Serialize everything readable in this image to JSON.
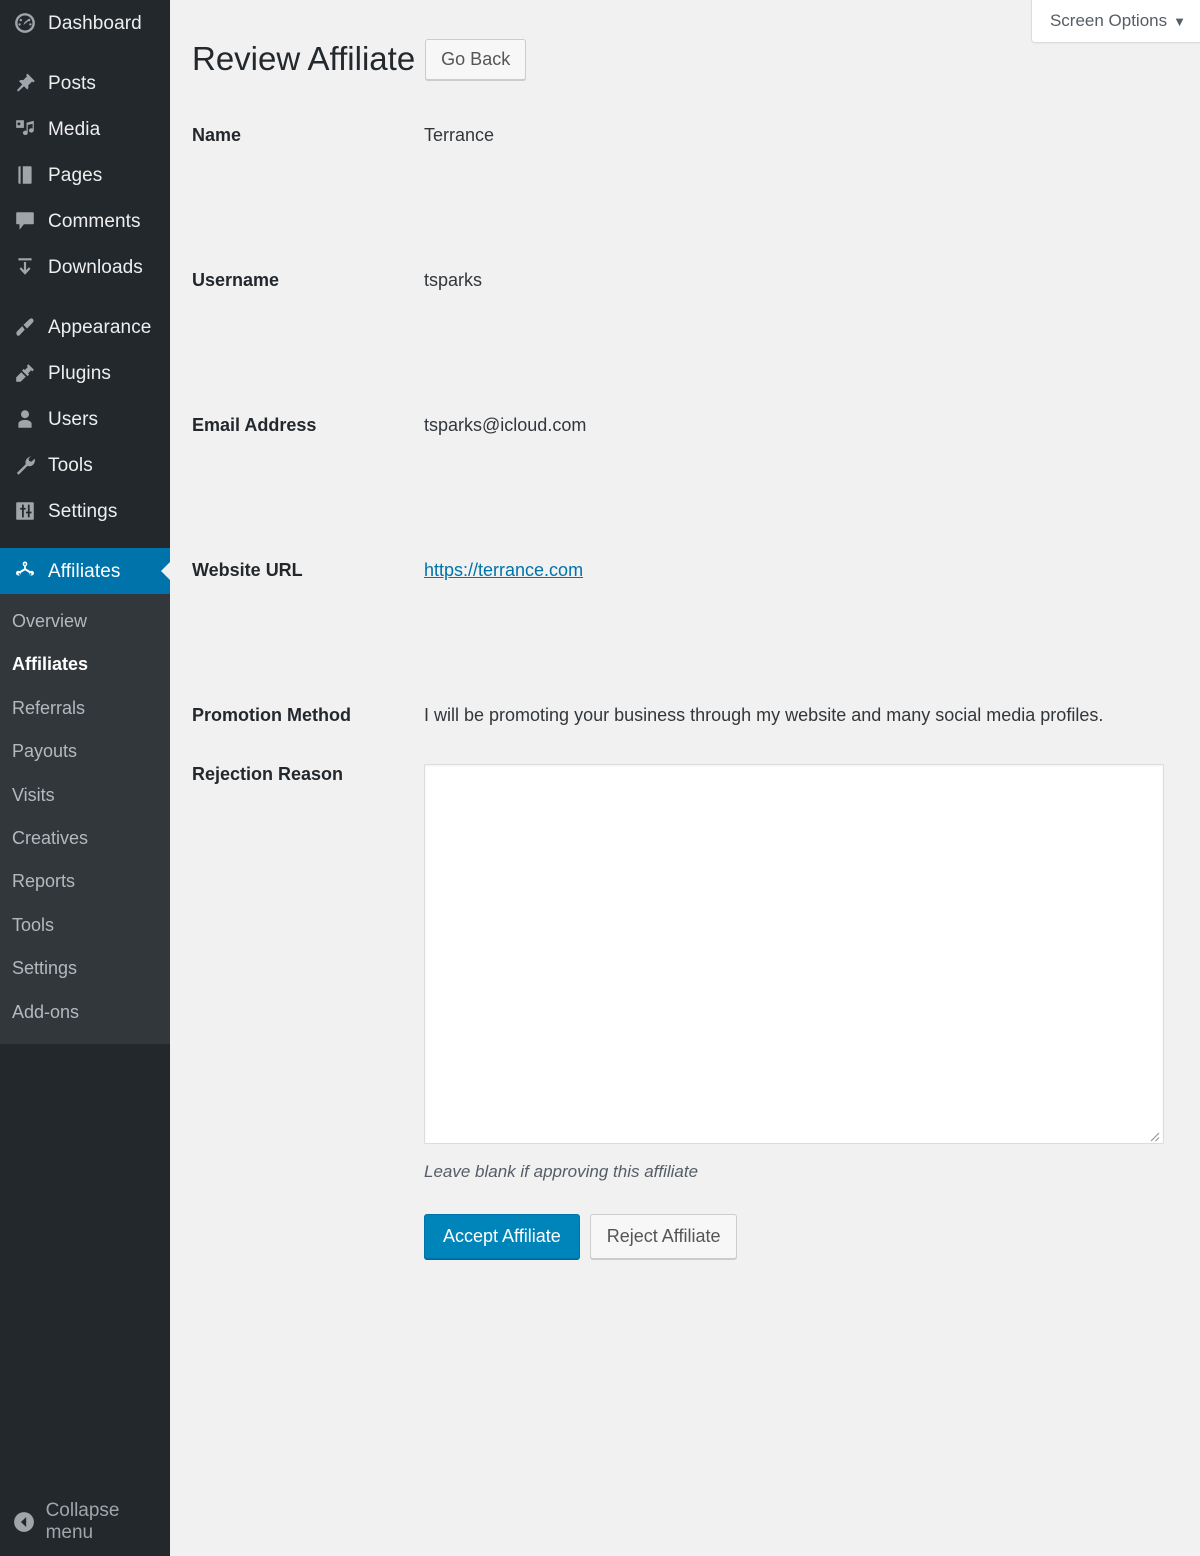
{
  "sidebar": {
    "items": [
      {
        "label": "Dashboard",
        "icon": "dashboard-icon",
        "name": "dashboard"
      },
      {
        "label": "Posts",
        "icon": "pin-icon",
        "name": "posts"
      },
      {
        "label": "Media",
        "icon": "media-icon",
        "name": "media"
      },
      {
        "label": "Pages",
        "icon": "pages-icon",
        "name": "pages"
      },
      {
        "label": "Comments",
        "icon": "comment-icon",
        "name": "comments"
      },
      {
        "label": "Downloads",
        "icon": "download-icon",
        "name": "downloads"
      },
      {
        "label": "Appearance",
        "icon": "brush-icon",
        "name": "appearance"
      },
      {
        "label": "Plugins",
        "icon": "plug-icon",
        "name": "plugins"
      },
      {
        "label": "Users",
        "icon": "user-icon",
        "name": "users"
      },
      {
        "label": "Tools",
        "icon": "wrench-icon",
        "name": "tools"
      },
      {
        "label": "Settings",
        "icon": "sliders-icon",
        "name": "settings"
      },
      {
        "label": "Affiliates",
        "icon": "network-icon",
        "name": "affiliates",
        "active": true
      }
    ],
    "submenu": [
      {
        "label": "Overview",
        "name": "overview"
      },
      {
        "label": "Affiliates",
        "name": "affiliates",
        "active": true
      },
      {
        "label": "Referrals",
        "name": "referrals"
      },
      {
        "label": "Payouts",
        "name": "payouts"
      },
      {
        "label": "Visits",
        "name": "visits"
      },
      {
        "label": "Creatives",
        "name": "creatives"
      },
      {
        "label": "Reports",
        "name": "reports"
      },
      {
        "label": "Tools",
        "name": "tools"
      },
      {
        "label": "Settings",
        "name": "settings"
      },
      {
        "label": "Add-ons",
        "name": "add-ons"
      }
    ],
    "collapse_label": "Collapse menu",
    "collapse_icon": "chevron-left-circle-icon",
    "colors": {
      "background": "#23282d",
      "submenu_background": "#32373c",
      "active": "#0073aa",
      "text": "#a0a5aa"
    }
  },
  "screen_meta": {
    "screen_options_label": "Screen Options",
    "caret": "▼"
  },
  "header": {
    "title": "Review Affiliate",
    "go_back_label": "Go Back"
  },
  "form": {
    "fields": [
      {
        "label": "Name",
        "value": "Terrance",
        "name": "name"
      },
      {
        "label": "Username",
        "value": "tsparks",
        "name": "username"
      },
      {
        "label": "Email Address",
        "value": "tsparks@icloud.com",
        "name": "email-address"
      },
      {
        "label": "Website URL",
        "value": "https://terrance.com",
        "name": "website-url",
        "is_link": true
      },
      {
        "label": "Promotion Method",
        "value": "I will be promoting your business through my website and many social media profiles.",
        "name": "promotion-method"
      }
    ],
    "rejection": {
      "label": "Rejection Reason",
      "value": "",
      "placeholder": "",
      "hint": "Leave blank if approving this affiliate"
    },
    "buttons": {
      "accept_label": "Accept Affiliate",
      "reject_label": "Reject Affiliate",
      "accept_color": "#0085ba"
    }
  }
}
